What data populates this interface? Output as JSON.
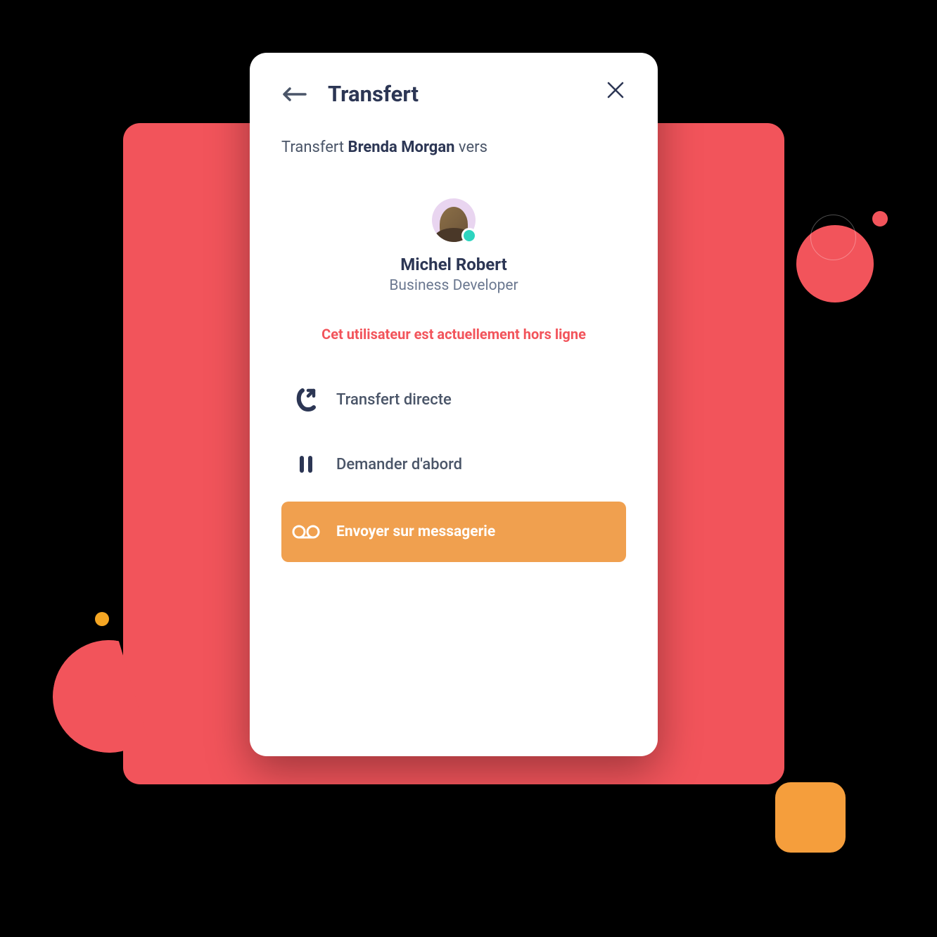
{
  "header": {
    "title": "Transfert"
  },
  "transfer": {
    "prefix": "Transfert ",
    "callerName": "Brenda Morgan",
    "suffix": " vers"
  },
  "contact": {
    "name": "Michel Robert",
    "role": "Business Developer",
    "statusColor": "#2DD4BF"
  },
  "warning": "Cet utilisateur est actuellement hors ligne",
  "options": {
    "direct": "Transfert directe",
    "askFirst": "Demander d'abord",
    "voicemail": "Envoyer sur messagerie"
  },
  "colors": {
    "accent": "#F2545B",
    "highlight": "#F0A04F",
    "text": "#2C3654"
  }
}
